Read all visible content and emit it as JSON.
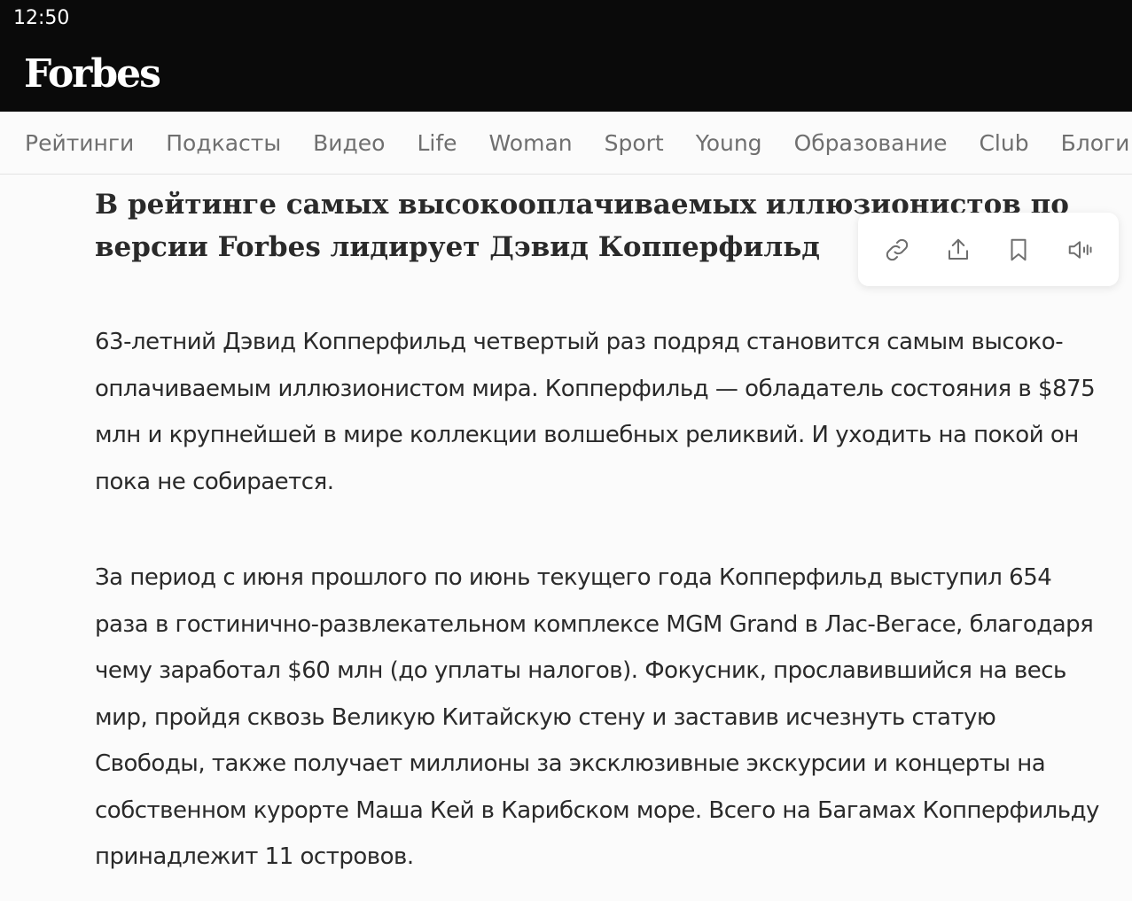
{
  "status_bar": {
    "time": "12:50"
  },
  "header": {
    "logo": "Forbes"
  },
  "nav": {
    "items": [
      "Рейтинги",
      "Подкасты",
      "Видео",
      "Life",
      "Woman",
      "Sport",
      "Young",
      "Образование",
      "Club",
      "Блоги"
    ]
  },
  "article": {
    "headline": "В рейтинге самых высокооплачиваемых иллюзионистов по вер­сии Forbes лидирует Дэвид Копперфильд",
    "paragraphs": [
      "63-летний Дэвид Копперфильд четвертый раз подряд становится самым высоко­оплачиваемым иллюзионистом мира. Копперфильд — обладатель состояния в $875 млн и крупнейшей в мире коллекции волшебных реликвий. И уходить на покой он пока не собирается.",
      "За период с июня прошлого по июнь текущего года Копперфильд выступил 654 раза в гостинично-развлекательном комплексе MGM Grand в Лас-Вегасе, благо­даря чему заработал $60 млн (до уплаты налогов). Фокусник, прославившийся на весь мир, пройдя сквозь Великую Китайскую стену и заставив исчезнуть статую Свободы, также получает миллионы за эксклюзивные экскурсии и концерты на собственном курорте Маша Кей в Карибском море. Всего на Багамах Коппер­фильду принадлежит 11 островов."
    ]
  },
  "toolbar": {
    "icons": [
      "link-icon",
      "share-icon",
      "bookmark-icon",
      "audio-icon"
    ]
  },
  "colors": {
    "header_bg": "#0a0a0a",
    "page_bg": "#fbfbfb",
    "nav_text": "#6f6f6f",
    "body_text": "#2a2a2a"
  }
}
